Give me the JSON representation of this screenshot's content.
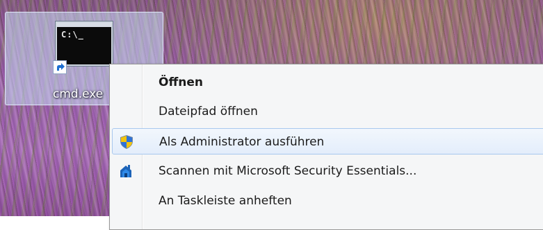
{
  "desktop": {
    "icon": {
      "label": "cmd.exe",
      "thumbnail_prompt": "C:\\_",
      "overlay_icon": "shortcut-arrow-icon"
    }
  },
  "context_menu": {
    "items": [
      {
        "label": "Öffnen",
        "bold": true,
        "icon": null,
        "highlighted": false
      },
      {
        "label": "Dateipfad öffnen",
        "bold": false,
        "icon": null,
        "highlighted": false
      },
      {
        "label": "Als Administrator ausführen",
        "bold": false,
        "icon": "uac-shield-icon",
        "highlighted": true
      },
      {
        "label": "Scannen mit Microsoft Security Essentials...",
        "bold": false,
        "icon": "security-essentials-icon",
        "highlighted": false
      },
      {
        "label": "An Taskleiste anheften",
        "bold": false,
        "icon": null,
        "highlighted": false
      }
    ]
  },
  "colors": {
    "menu_background": "#f5f6f7",
    "highlight_border": "#a8c8ee",
    "highlight_fill": "#e3edfb"
  }
}
